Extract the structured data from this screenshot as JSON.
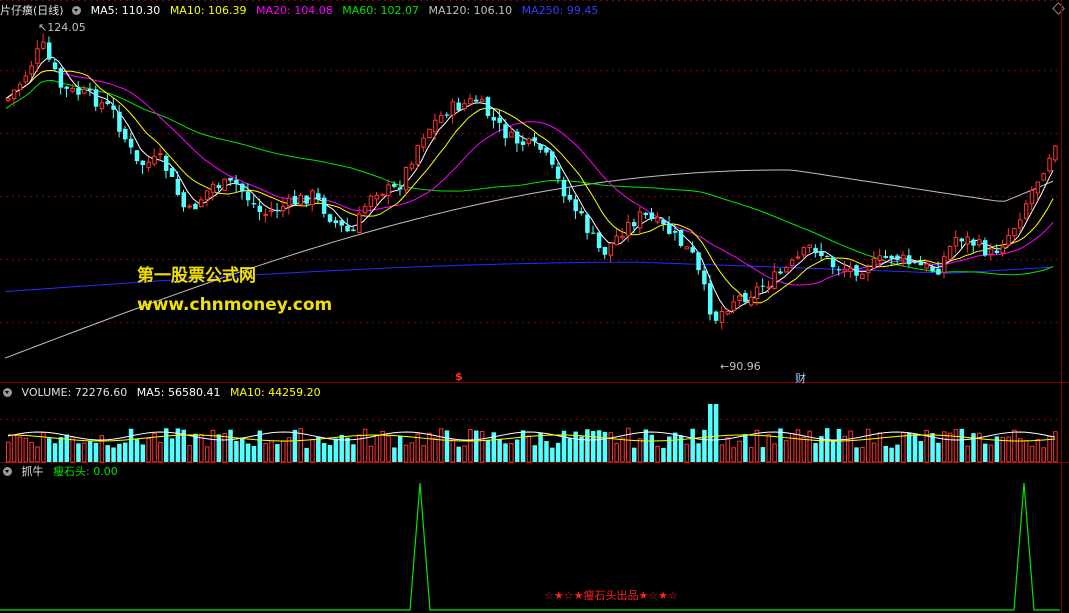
{
  "main_panel": {
    "title": "片仔癀(日线)",
    "ma5": "MA5: 110.30",
    "ma10": "MA10: 106.39",
    "ma20": "MA20: 104.08",
    "ma60": "MA60: 102.07",
    "ma120": "MA120: 106.10",
    "ma250": "MA250: 99.45",
    "high_label": "124.05",
    "low_label": "90.96",
    "marker_dollar": "$",
    "marker_cai": "财",
    "watermark_cn": "第一股票公式网",
    "watermark_url": "www.chnmoney.com"
  },
  "volume_panel": {
    "title": "VOLUME: 72276.60",
    "ma5": "MA5: 56580.41",
    "ma10": "MA10: 44259.20"
  },
  "indicator_panel": {
    "title": "抓牛",
    "value": "瘦石头: 0.00",
    "credit": "☆★☆★瘦石头出品★☆★☆"
  },
  "colors": {
    "up": "#ff3232",
    "down": "#54ffff",
    "ma5": "#ffffff",
    "ma10": "#ffff00",
    "ma20": "#ff00ff",
    "ma60": "#00e600",
    "ma120": "#c0c0c0",
    "ma250": "#2a2aff",
    "grid": "#800000"
  },
  "chart_data": {
    "type": "candlestick",
    "price_high": 124.05,
    "price_low": 90.96,
    "indicator_series": [
      {
        "name": "瘦石头",
        "spikes": 2
      }
    ]
  }
}
